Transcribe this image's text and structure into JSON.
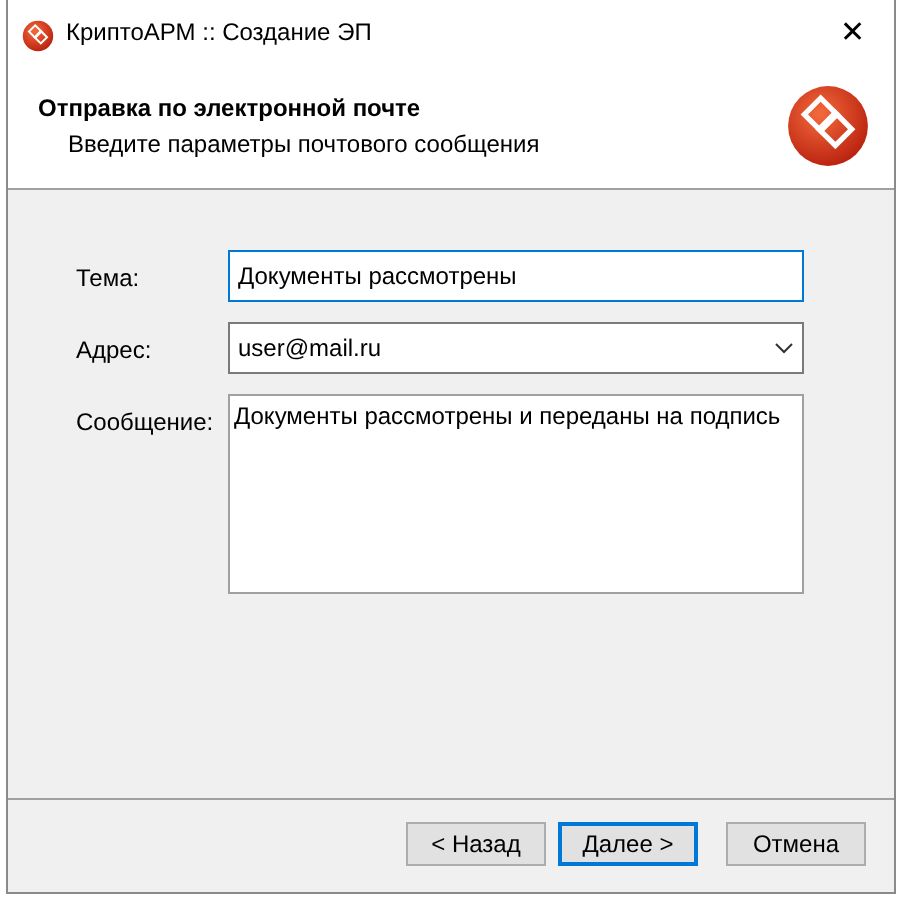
{
  "window": {
    "title": "КриптоАРМ :: Создание ЭП",
    "close": "✕"
  },
  "header": {
    "title": "Отправка по электронной почте",
    "subtitle": "Введите параметры почтового сообщения"
  },
  "fields": [
    {
      "kind": "text",
      "label": "Тема:",
      "value": "Документы рассмотрены",
      "focused": true
    },
    {
      "kind": "combo",
      "label": "Адрес:",
      "value": "user@mail.ru",
      "focused": false
    },
    {
      "kind": "textarea",
      "label": "Сообщение:",
      "value": "Документы рассмотрены и переданы на подпись",
      "focused": false
    }
  ],
  "buttons": [
    {
      "label": "< Назад",
      "default": false
    },
    {
      "label": "Далее >",
      "default": true
    },
    {
      "label": "Отмена",
      "default": false
    }
  ]
}
